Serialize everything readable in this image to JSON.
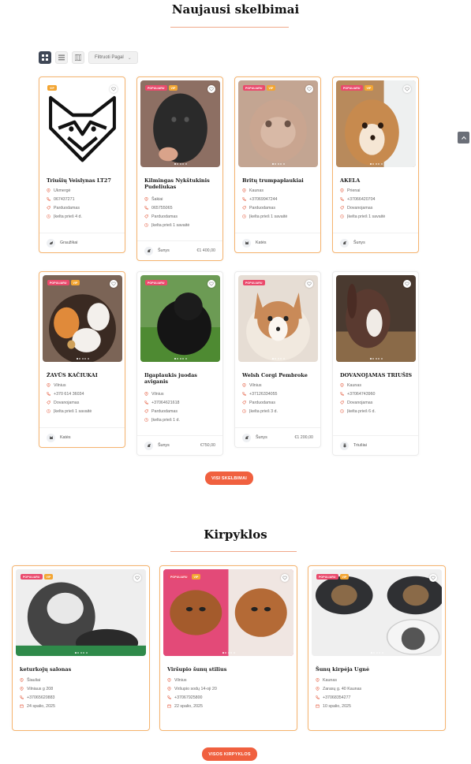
{
  "listings_section": {
    "title": "Naujausi skelbimai",
    "filter_label": "Filtruoti Pagal",
    "view_all_label": "VISI SKELBIMAI",
    "cards": [
      {
        "title": "Triušių Veislynas LT27",
        "rows": [
          [
            "pin",
            "Ukmergė"
          ],
          [
            "phone",
            "067437271"
          ],
          [
            "tag",
            "Parduodamas"
          ],
          [
            "clock",
            "Įkelta prieš 4 d."
          ]
        ],
        "category": "Graužikai",
        "price": "",
        "badges": [
          "vip"
        ]
      },
      {
        "title": "Kilmingas Nykštukinis Pudeliukas",
        "rows": [
          [
            "pin",
            "Šakiai"
          ],
          [
            "phone",
            "065755065"
          ],
          [
            "tag",
            "Parduodamas"
          ],
          [
            "clock",
            "Įkelta prieš 1 savaitė"
          ]
        ],
        "category": "Šunys",
        "price": "€1 400,00",
        "badges": [
          "pop",
          "vip"
        ]
      },
      {
        "title": "Britų trumpaplaukiai",
        "rows": [
          [
            "pin",
            "Kaunas"
          ],
          [
            "phone",
            "+37069947244"
          ],
          [
            "tag",
            "Parduodamas"
          ],
          [
            "clock",
            "Įkelta prieš 1 savaitė"
          ]
        ],
        "category": "Katės",
        "price": "",
        "badges": [
          "pop",
          "vip"
        ]
      },
      {
        "title": "AKELA",
        "rows": [
          [
            "pin",
            "Prienai"
          ],
          [
            "phone",
            "+37066420704"
          ],
          [
            "tag",
            "Dovanojamas"
          ],
          [
            "clock",
            "Įkelta prieš 1 savaitė"
          ]
        ],
        "category": "Šunys",
        "price": "",
        "badges": [
          "pop",
          "vip"
        ]
      },
      {
        "title": "ŽAVŪS KAČIUKAI",
        "rows": [
          [
            "pin",
            "Vilnius"
          ],
          [
            "phone",
            "+370 614 36034"
          ],
          [
            "tag",
            "Dovanojamas"
          ],
          [
            "clock",
            "Įkelta prieš 1 savaitė"
          ]
        ],
        "category": "Katės",
        "price": "",
        "badges": [
          "pop",
          "vip"
        ]
      },
      {
        "title": "Ilgaplaukis juodas aviganis",
        "rows": [
          [
            "pin",
            "Vilnius"
          ],
          [
            "phone",
            "+37064621618"
          ],
          [
            "tag",
            "Parduodamas"
          ],
          [
            "clock",
            "Įkelta prieš 1 d."
          ]
        ],
        "category": "Šunys",
        "price": "€750,00",
        "badges": [
          "pop"
        ]
      },
      {
        "title": "Welsh Corgi Pembroke",
        "rows": [
          [
            "pin",
            "Vilnius"
          ],
          [
            "phone",
            "+37126334055"
          ],
          [
            "tag",
            "Parduodamas"
          ],
          [
            "clock",
            "Įkelta prieš 3 d."
          ]
        ],
        "category": "Šunys",
        "price": "€1 200,00",
        "badges": [
          "pop"
        ]
      },
      {
        "title": "DOVANOJAMAS TRIUŠIS",
        "rows": [
          [
            "pin",
            "Kaunas"
          ],
          [
            "phone",
            "+37064743960"
          ],
          [
            "tag",
            "Dovanojamas"
          ],
          [
            "clock",
            "Įkelta prieš 6 d."
          ]
        ],
        "category": "Triušiai",
        "price": "",
        "badges": []
      }
    ]
  },
  "groomers_section": {
    "title": "Kirpyklos",
    "view_all_label": "VISOS KIRPYKLOS",
    "cards": [
      {
        "title": "keturkojų salonas",
        "rows": [
          [
            "pin",
            "Šiauliai"
          ],
          [
            "pin",
            "Vilniaus g 208"
          ],
          [
            "phone",
            "+37065620883"
          ],
          [
            "cal",
            "24 spalio, 2025"
          ]
        ],
        "badges": [
          "pop",
          "vip"
        ]
      },
      {
        "title": "Viršupio šunų stilius",
        "rows": [
          [
            "pin",
            "Vilnius"
          ],
          [
            "pin",
            "Viršupio sodų 14-oji 20"
          ],
          [
            "phone",
            "+37067925800"
          ],
          [
            "cal",
            "22 spalio, 2025"
          ]
        ],
        "badges": [
          "pop",
          "vip"
        ]
      },
      {
        "title": "Šunų kirpėja Ugnė",
        "rows": [
          [
            "pin",
            "Kaunas"
          ],
          [
            "pin",
            "Zarasų g. 40 Kaunas"
          ],
          [
            "phone",
            "+37068354277"
          ],
          [
            "cal",
            "10 spalio, 2025"
          ]
        ],
        "badges": [
          "pop",
          "vip"
        ]
      }
    ]
  },
  "badge_labels": {
    "pop": "POPULIARU",
    "vip": "VIP"
  },
  "colors": {
    "accent": "#f0603f",
    "vip_border": "#f6b46f",
    "popular_badge": "#ea4a6c",
    "vip_badge": "#f3a532",
    "icon_red": "#e8735a"
  },
  "icons": {
    "pin": "location-icon",
    "phone": "phone-icon",
    "tag": "tag-icon",
    "clock": "clock-icon",
    "cal": "calendar-icon"
  }
}
